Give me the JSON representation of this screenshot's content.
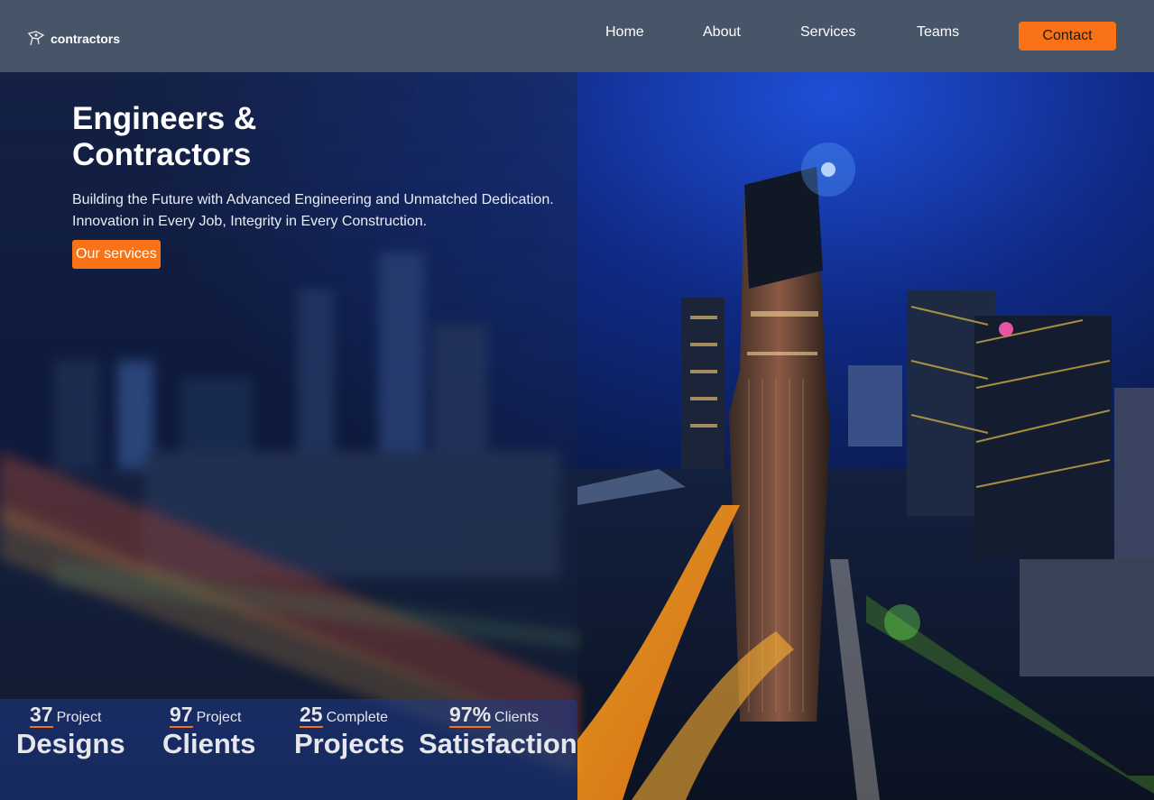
{
  "header": {
    "logo_text": "contractors",
    "logo_icon": "pencil-compass-icon",
    "nav": [
      {
        "label": "Home"
      },
      {
        "label": "About"
      },
      {
        "label": "Services"
      },
      {
        "label": "Teams"
      }
    ],
    "contact_label": "Contact"
  },
  "hero": {
    "title_line1": "Engineers &",
    "title_line2": "Contractors",
    "subtitle": "Building the Future with Advanced Engineering and Unmatched Dedication. Innovation in Every Job, Integrity in Every Construction.",
    "cta_label": "Our services"
  },
  "stats": [
    {
      "number": "37",
      "small": "Project",
      "big": "Designs"
    },
    {
      "number": "97",
      "small": "Project",
      "big": "Clients"
    },
    {
      "number": "25",
      "small": "Complete",
      "big": "Projects"
    },
    {
      "number": "97%",
      "small": "Clients",
      "big": "Satisfaction"
    }
  ],
  "colors": {
    "header_bg": "#475569",
    "accent": "#f97316",
    "stats_bg": "#1e3a8a"
  }
}
